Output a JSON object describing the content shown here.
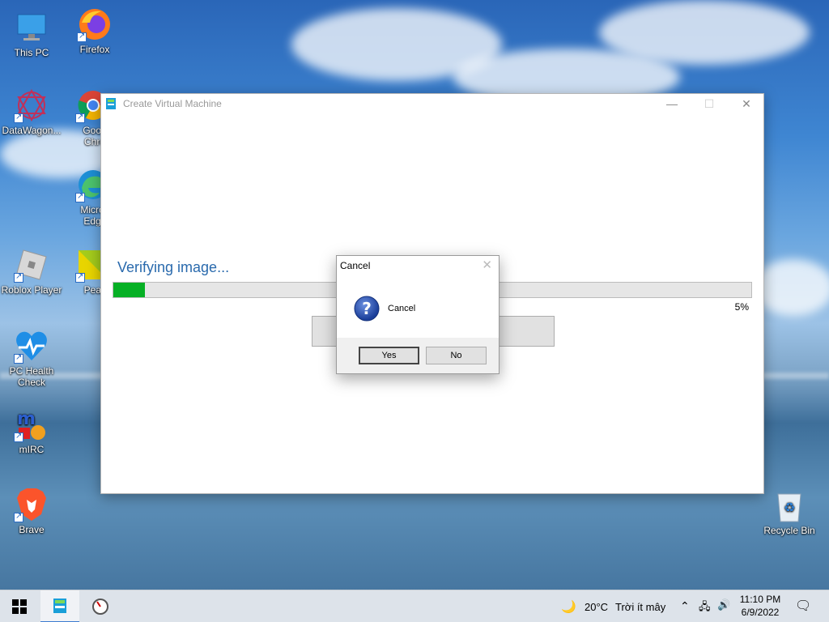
{
  "desktop": {
    "icons": [
      {
        "label": "This PC"
      },
      {
        "label": "Firefox"
      },
      {
        "label": "DataWagon..."
      },
      {
        "label": "Goog Chro"
      },
      {
        "label": "Micro Edg"
      },
      {
        "label": "Roblox Player"
      },
      {
        "label": "PeaZ"
      },
      {
        "label": "PC Health Check"
      },
      {
        "label": "mIRC"
      },
      {
        "label": "Brave"
      },
      {
        "label": "Recycle Bin"
      }
    ]
  },
  "window": {
    "title": "Create Virtual Machine",
    "status_label": "Verifying image...",
    "progress_percent": 5,
    "progress_text": "5%"
  },
  "dialog": {
    "title": "Cancel",
    "message": "Cancel",
    "yes_label": "Yes",
    "no_label": "No"
  },
  "taskbar": {
    "weather_temp": "20°C",
    "weather_desc": "Trời ít mây",
    "time": "11:10 PM",
    "date": "6/9/2022"
  },
  "colors": {
    "progress_fill": "#06b025",
    "accent": "#2a6aad"
  }
}
